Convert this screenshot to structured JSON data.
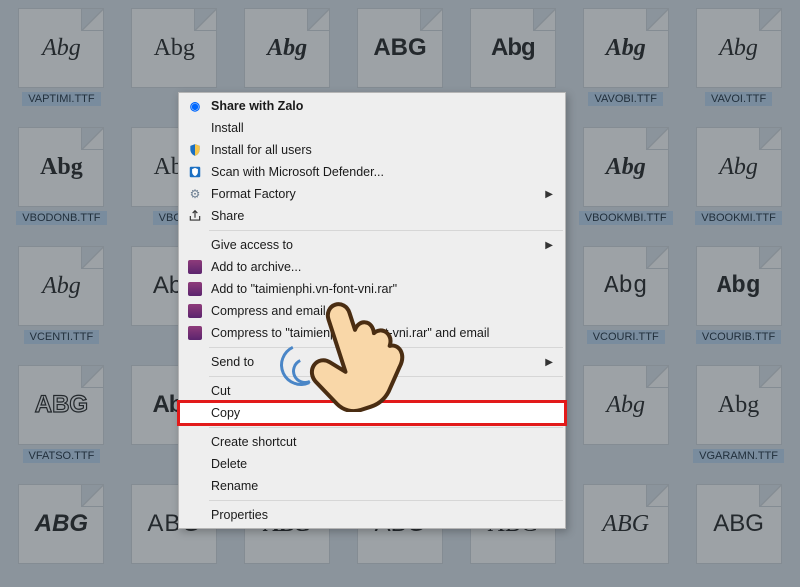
{
  "sample_text": "Abg",
  "variant_text": "ABG",
  "rows": [
    [
      {
        "label": "VAPTIMI.TTF",
        "cls": "s-italic"
      },
      {
        "label": "",
        "cls": "s-serif"
      },
      {
        "label": "",
        "cls": "s-script s-bolditalic"
      },
      {
        "label": "",
        "cls": "s-extrabold",
        "variant": true
      },
      {
        "label": "",
        "cls": "s-black"
      },
      {
        "label": "VAVOBI.TTF",
        "cls": "s-serif s-bolditalic"
      },
      {
        "label": "VAVOI.TTF",
        "cls": "s-serif s-italic"
      }
    ],
    [
      {
        "label": "VBODONB.TTF",
        "cls": "s-serif",
        "bold": true
      },
      {
        "label": "VBOD",
        "cls": "s-serif"
      },
      {
        "label": "",
        "cls": "s-serif s-italic"
      },
      {
        "label": "",
        "cls": "s-serif"
      },
      {
        "label": "",
        "cls": "s-serif"
      },
      {
        "label": "VBOOKMBI.TTF",
        "cls": "s-serif s-bolditalic"
      },
      {
        "label": "VBOOKMI.TTF",
        "cls": "s-serif s-italic"
      }
    ],
    [
      {
        "label": "VCENTI.TTF",
        "cls": "s-italic"
      },
      {
        "label": "",
        "cls": "s-light"
      },
      {
        "label": "",
        "cls": "s-serif"
      },
      {
        "label": "",
        "cls": "s-serif"
      },
      {
        "label": "",
        "cls": "s-mono"
      },
      {
        "label": "VCOURI.TTF",
        "cls": "s-mono"
      },
      {
        "label": "VCOURIB.TTF",
        "cls": "s-mono",
        "bold": true
      }
    ],
    [
      {
        "label": "VFATSO.TTF",
        "cls": "s-outline",
        "variant": true
      },
      {
        "label": "",
        "cls": "s-black"
      },
      {
        "label": "",
        "cls": "s-light"
      },
      {
        "label": "",
        "cls": "s-serif"
      },
      {
        "label": "",
        "cls": "s-serif"
      },
      {
        "label": "",
        "cls": "s-serif s-italic"
      },
      {
        "label": "VGARAMN.TTF",
        "cls": "s-serif"
      }
    ],
    [
      {
        "label": "",
        "cls": "s-bolditalic",
        "variant": true
      },
      {
        "label": "",
        "cls": "s-smallcaps",
        "variant": true
      },
      {
        "label": "",
        "cls": "s-black s-italic",
        "variant": true
      },
      {
        "label": "",
        "cls": "s-light",
        "variant": true
      },
      {
        "label": "",
        "cls": "s-serif",
        "variant": true
      },
      {
        "label": "",
        "cls": "s-script",
        "variant": true
      },
      {
        "label": "",
        "cls": "s-light",
        "variant": true
      }
    ]
  ],
  "menu": {
    "share_zalo": "Share with Zalo",
    "install": "Install",
    "install_all": "Install for all users",
    "defender": "Scan with Microsoft Defender...",
    "format_factory": "Format Factory",
    "share": "Share",
    "give_access": "Give access to",
    "add_archive": "Add to archive...",
    "add_named": "Add to \"taimienphi.vn-font-vni.rar\"",
    "compress_email": "Compress and email...",
    "compress_named_email": "Compress to \"taimienphi.vn-font-vni.rar\" and email",
    "send_to": "Send to",
    "cut": "Cut",
    "copy": "Copy",
    "create_shortcut": "Create shortcut",
    "delete": "Delete",
    "rename": "Rename",
    "properties": "Properties"
  }
}
